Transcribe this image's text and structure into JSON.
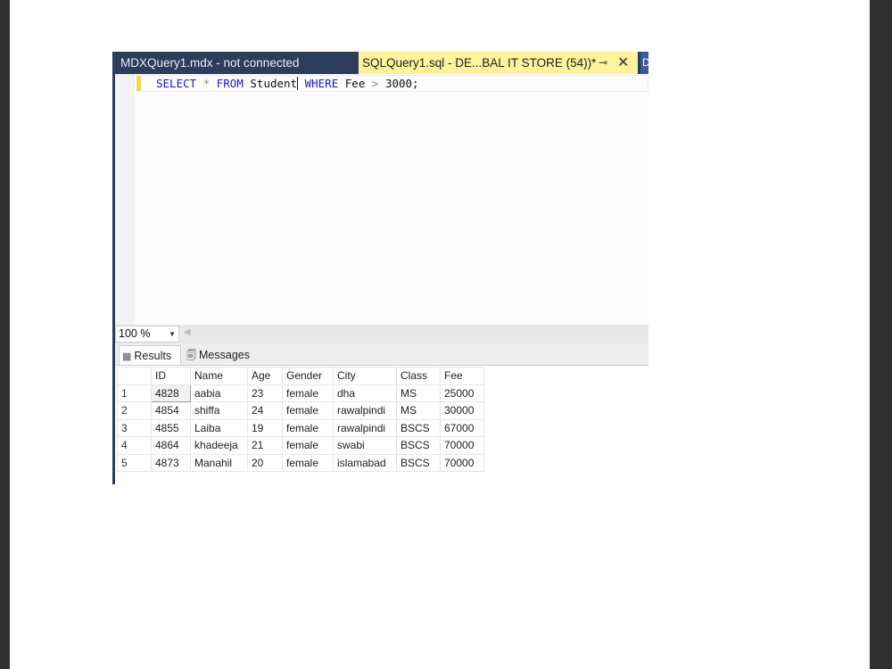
{
  "tabs": [
    {
      "label": "MDXQuery1.mdx - not connected",
      "active": false
    },
    {
      "label": "SQLQuery1.sql - DE...BAL IT STORE (54))*",
      "active": true
    },
    {
      "label": "D",
      "active": false
    }
  ],
  "tab_icons": {
    "pin": "pin-icon",
    "close": "close-icon"
  },
  "editor": {
    "sql": {
      "kw1": "SELECT",
      "star": "*",
      "kw2": "FROM",
      "table": "Student",
      "kw3": "WHERE",
      "col": "Fee",
      "op": ">",
      "val": "3000;"
    }
  },
  "zoom": {
    "value": "100 %"
  },
  "results_tabs": {
    "results": "Results",
    "messages": "Messages"
  },
  "grid": {
    "columns": [
      "ID",
      "Name",
      "Age",
      "Gender",
      "City",
      "Class",
      "Fee"
    ],
    "rows": [
      {
        "n": "1",
        "cells": [
          "4828",
          "aabia",
          "23",
          "female",
          "dha",
          "MS",
          "25000"
        ]
      },
      {
        "n": "2",
        "cells": [
          "4854",
          "shiffa",
          "24",
          "female",
          "rawalpindi",
          "MS",
          "30000"
        ]
      },
      {
        "n": "3",
        "cells": [
          "4855",
          "Laiba",
          "19",
          "female",
          "rawalpindi",
          "BSCS",
          "67000"
        ]
      },
      {
        "n": "4",
        "cells": [
          "4864",
          "khadeeja",
          "21",
          "female",
          "swabi",
          "BSCS",
          "70000"
        ]
      },
      {
        "n": "5",
        "cells": [
          "4873",
          "Manahil",
          "20",
          "female",
          "islamabad",
          "BSCS",
          "70000"
        ]
      }
    ]
  },
  "colors": {
    "tabstrip": "#2d3e5c",
    "active_tab": "#fff29d",
    "keyword": "#1a1ad0",
    "change_bar": "#f2d94a"
  }
}
